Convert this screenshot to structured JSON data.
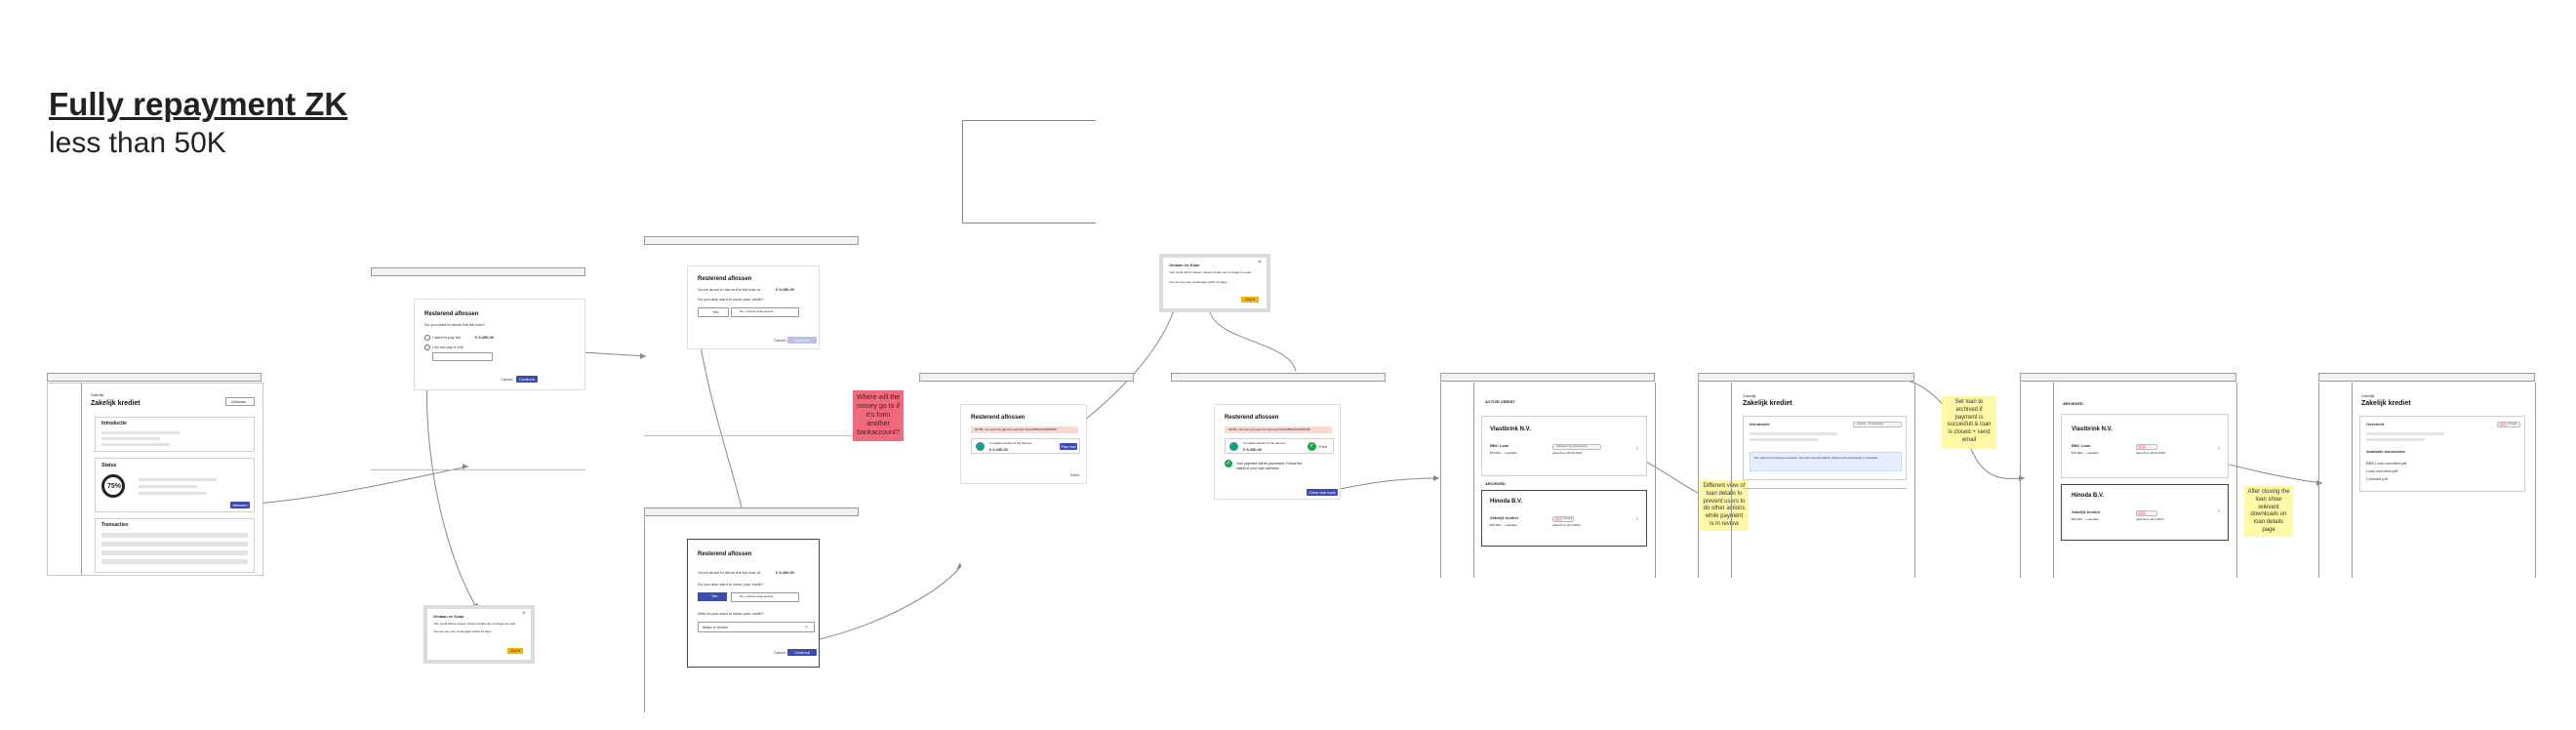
{
  "board": {
    "title": "Fully repayment ZK",
    "subtitle": "less than 50K"
  },
  "screens": {
    "loan_detail": {
      "kicker": "Zakelijk",
      "heading": "Zakelijk krediet",
      "top_button": "Aflossen",
      "intro_title": "Introductie",
      "status_title": "Status",
      "progress": "75%",
      "progress_fraction": 0.75,
      "cta": "Aflossen",
      "transactions_title": "Transacties"
    },
    "modal1": {
      "title": "Resterend aflossen",
      "question": "Do you want to return the full loan?",
      "amount": "€ 9.450,00",
      "option_full": "I want to pay full",
      "option_other": "I do not pay in full",
      "cancel": "Cancel",
      "confirm": "Continue"
    },
    "modal2": {
      "title": "Resterend aflossen",
      "line1": "You're about to return the full loan of",
      "amount": "€ 9.450,00",
      "line2": "Do you also want to close your credit?",
      "option_yes": "Yes",
      "option_no": "No, I want to keep access",
      "cancel": "Cancel",
      "confirm": "Continue"
    },
    "modal3": {
      "title": "Resterend aflossen",
      "line1": "You're about to return the full loan of",
      "amount": "€ 9.450,00",
      "line2": "Do you also want to close your credit?",
      "option_yes": "Yes",
      "option_no": "No, I want to keep access",
      "reason_q": "Why do you want to close your credit?",
      "reason_placeholder": "Make a choice",
      "cancel": "Cancel",
      "confirm": "Continue"
    },
    "small_modal": {
      "title": "Gedaan en Klaar",
      "body1": "Your credit will be closed. Closed credits can no longer be used.",
      "body2": "You can use your credit again within 14 days.",
      "confirm": "Got it"
    },
    "confirm_modal": {
      "title": "Resterend aflossen",
      "warning": "NOTE: You can only pay from account NL12ABNA0123456789",
      "row_title": "Complete transfer of the full loan",
      "row_amount": "€ 9.450,00",
      "pay_button": "Pay now",
      "done": "Done"
    },
    "success_modal": {
      "title": "Resterend aflossen",
      "warning": "NOTE: You can only pay from account NL12ABNA0123456789",
      "row_title": "Complete transfer of the full loan",
      "row_amount": "€ 9.450,00",
      "paid_label": "Paid",
      "success_text": "Your payment will be processed. Follow the status of your loan overview.",
      "button": "Close and back"
    },
    "overview": {
      "section_active": "ACTIVE CREDIT",
      "company": "Vlastbrink N.V.",
      "product1": "BBC Loan",
      "product1_detail": "€70.000,- - Loanable",
      "product1_date": "paid off on 20-03-2023",
      "tag1": "Followed by processing",
      "section_archived": "ARCHIVED",
      "company2": "Hinoda B.V.",
      "product2": "Zakelijk krediet",
      "product2_detail": "€45.000,- - Loanable",
      "product2_date": "paid off on 20-3-2023",
      "tag2": "Closed"
    },
    "closed_detail": {
      "kicker": "Zakelijk",
      "heading": "Zakelijk krediet",
      "section": "Introductie",
      "tag": "Closed - Processing",
      "notice": "Your payment is being processed. Your loan account will be closed once processing is complete."
    },
    "archived": {
      "section": "ARCHIVED",
      "company": "Vlastbrink N.V.",
      "product1": "BBC Loan",
      "product1_detail": "€70.000,- - Loanable",
      "product1_date": "paid off on 20-03-2023",
      "company2": "Hinoda B.V.",
      "product2": "Zakelijk krediet",
      "product2_detail": "€45.000,- - Loanable",
      "product2_date": "paid off on 20-3-2023"
    },
    "final_detail": {
      "kicker": "Zakelijk",
      "heading": "Zakelijk krediet",
      "section1": "Overzicht",
      "section2": "Available documents",
      "doc1": "BBB Loan overview.pdf",
      "doc2": "Loan overview.pdf",
      "doc3": "Contract.pdf",
      "tag": "Closed"
    }
  },
  "notes": {
    "red": "Where will the money go to if it's from another bankaccount?",
    "yellow1": "Different view of loan details to prevent users to do other actions while payment is in review",
    "yellow2": "Set loan to archived if payment is succesfull & loan is closed + send email",
    "yellow3": "After closing the loan show relevant downloads on loan details page"
  },
  "colors": {
    "primary": "#3b4bb2",
    "warning_bg": "#f9d9cf",
    "sticky_yellow": "#fff8a6",
    "sticky_red": "#f06a7d",
    "success": "#1ca34a",
    "accent_yellow": "#f5b400"
  }
}
